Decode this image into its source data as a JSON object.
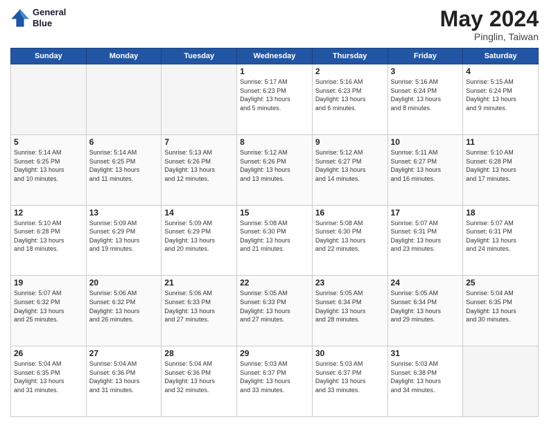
{
  "header": {
    "logo_line1": "General",
    "logo_line2": "Blue",
    "month_year": "May 2024",
    "location": "Pinglin, Taiwan"
  },
  "weekdays": [
    "Sunday",
    "Monday",
    "Tuesday",
    "Wednesday",
    "Thursday",
    "Friday",
    "Saturday"
  ],
  "weeks": [
    [
      {
        "day": "",
        "info": ""
      },
      {
        "day": "",
        "info": ""
      },
      {
        "day": "",
        "info": ""
      },
      {
        "day": "1",
        "info": "Sunrise: 5:17 AM\nSunset: 6:23 PM\nDaylight: 13 hours\nand 5 minutes."
      },
      {
        "day": "2",
        "info": "Sunrise: 5:16 AM\nSunset: 6:23 PM\nDaylight: 13 hours\nand 6 minutes."
      },
      {
        "day": "3",
        "info": "Sunrise: 5:16 AM\nSunset: 6:24 PM\nDaylight: 13 hours\nand 8 minutes."
      },
      {
        "day": "4",
        "info": "Sunrise: 5:15 AM\nSunset: 6:24 PM\nDaylight: 13 hours\nand 9 minutes."
      }
    ],
    [
      {
        "day": "5",
        "info": "Sunrise: 5:14 AM\nSunset: 6:25 PM\nDaylight: 13 hours\nand 10 minutes."
      },
      {
        "day": "6",
        "info": "Sunrise: 5:14 AM\nSunset: 6:25 PM\nDaylight: 13 hours\nand 11 minutes."
      },
      {
        "day": "7",
        "info": "Sunrise: 5:13 AM\nSunset: 6:26 PM\nDaylight: 13 hours\nand 12 minutes."
      },
      {
        "day": "8",
        "info": "Sunrise: 5:12 AM\nSunset: 6:26 PM\nDaylight: 13 hours\nand 13 minutes."
      },
      {
        "day": "9",
        "info": "Sunrise: 5:12 AM\nSunset: 6:27 PM\nDaylight: 13 hours\nand 14 minutes."
      },
      {
        "day": "10",
        "info": "Sunrise: 5:11 AM\nSunset: 6:27 PM\nDaylight: 13 hours\nand 16 minutes."
      },
      {
        "day": "11",
        "info": "Sunrise: 5:10 AM\nSunset: 6:28 PM\nDaylight: 13 hours\nand 17 minutes."
      }
    ],
    [
      {
        "day": "12",
        "info": "Sunrise: 5:10 AM\nSunset: 6:28 PM\nDaylight: 13 hours\nand 18 minutes."
      },
      {
        "day": "13",
        "info": "Sunrise: 5:09 AM\nSunset: 6:29 PM\nDaylight: 13 hours\nand 19 minutes."
      },
      {
        "day": "14",
        "info": "Sunrise: 5:09 AM\nSunset: 6:29 PM\nDaylight: 13 hours\nand 20 minutes."
      },
      {
        "day": "15",
        "info": "Sunrise: 5:08 AM\nSunset: 6:30 PM\nDaylight: 13 hours\nand 21 minutes."
      },
      {
        "day": "16",
        "info": "Sunrise: 5:08 AM\nSunset: 6:30 PM\nDaylight: 13 hours\nand 22 minutes."
      },
      {
        "day": "17",
        "info": "Sunrise: 5:07 AM\nSunset: 6:31 PM\nDaylight: 13 hours\nand 23 minutes."
      },
      {
        "day": "18",
        "info": "Sunrise: 5:07 AM\nSunset: 6:31 PM\nDaylight: 13 hours\nand 24 minutes."
      }
    ],
    [
      {
        "day": "19",
        "info": "Sunrise: 5:07 AM\nSunset: 6:32 PM\nDaylight: 13 hours\nand 25 minutes."
      },
      {
        "day": "20",
        "info": "Sunrise: 5:06 AM\nSunset: 6:32 PM\nDaylight: 13 hours\nand 26 minutes."
      },
      {
        "day": "21",
        "info": "Sunrise: 5:06 AM\nSunset: 6:33 PM\nDaylight: 13 hours\nand 27 minutes."
      },
      {
        "day": "22",
        "info": "Sunrise: 5:05 AM\nSunset: 6:33 PM\nDaylight: 13 hours\nand 27 minutes."
      },
      {
        "day": "23",
        "info": "Sunrise: 5:05 AM\nSunset: 6:34 PM\nDaylight: 13 hours\nand 28 minutes."
      },
      {
        "day": "24",
        "info": "Sunrise: 5:05 AM\nSunset: 6:34 PM\nDaylight: 13 hours\nand 29 minutes."
      },
      {
        "day": "25",
        "info": "Sunrise: 5:04 AM\nSunset: 6:35 PM\nDaylight: 13 hours\nand 30 minutes."
      }
    ],
    [
      {
        "day": "26",
        "info": "Sunrise: 5:04 AM\nSunset: 6:35 PM\nDaylight: 13 hours\nand 31 minutes."
      },
      {
        "day": "27",
        "info": "Sunrise: 5:04 AM\nSunset: 6:36 PM\nDaylight: 13 hours\nand 31 minutes."
      },
      {
        "day": "28",
        "info": "Sunrise: 5:04 AM\nSunset: 6:36 PM\nDaylight: 13 hours\nand 32 minutes."
      },
      {
        "day": "29",
        "info": "Sunrise: 5:03 AM\nSunset: 6:37 PM\nDaylight: 13 hours\nand 33 minutes."
      },
      {
        "day": "30",
        "info": "Sunrise: 5:03 AM\nSunset: 6:37 PM\nDaylight: 13 hours\nand 33 minutes."
      },
      {
        "day": "31",
        "info": "Sunrise: 5:03 AM\nSunset: 6:38 PM\nDaylight: 13 hours\nand 34 minutes."
      },
      {
        "day": "",
        "info": ""
      }
    ]
  ]
}
